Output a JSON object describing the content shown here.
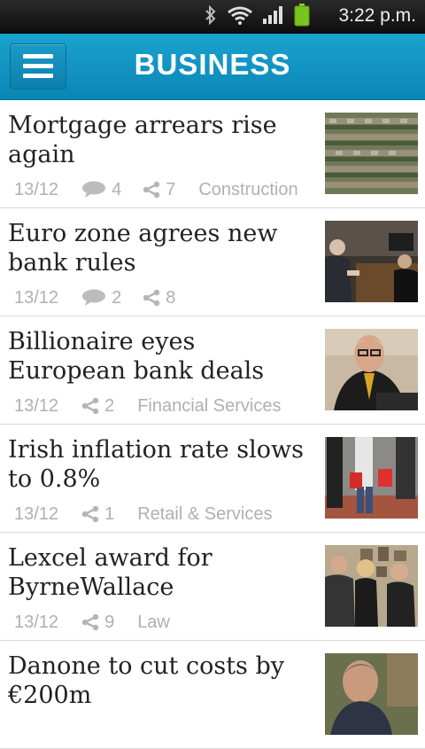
{
  "status_bar": {
    "time": "3:22 p.m."
  },
  "header": {
    "title": "BUSINESS"
  },
  "articles": [
    {
      "title": "Mortgage arrears rise again",
      "date": "13/12",
      "comments": "4",
      "shares": "7",
      "category": "Construction"
    },
    {
      "title": "Euro zone agrees new bank rules",
      "date": "13/12",
      "comments": "2",
      "shares": "8",
      "category": ""
    },
    {
      "title": "Billionaire eyes European bank deals",
      "date": "13/12",
      "shares": "2",
      "category": "Financial Services"
    },
    {
      "title": "Irish inflation rate slows to 0.8%",
      "date": "13/12",
      "shares": "1",
      "category": "Retail & Services"
    },
    {
      "title": "Lexcel award for ByrneWallace",
      "date": "13/12",
      "shares": "9",
      "category": "Law"
    },
    {
      "title": "Danone to cut costs by €200m",
      "date": "",
      "shares": "",
      "category": ""
    }
  ]
}
